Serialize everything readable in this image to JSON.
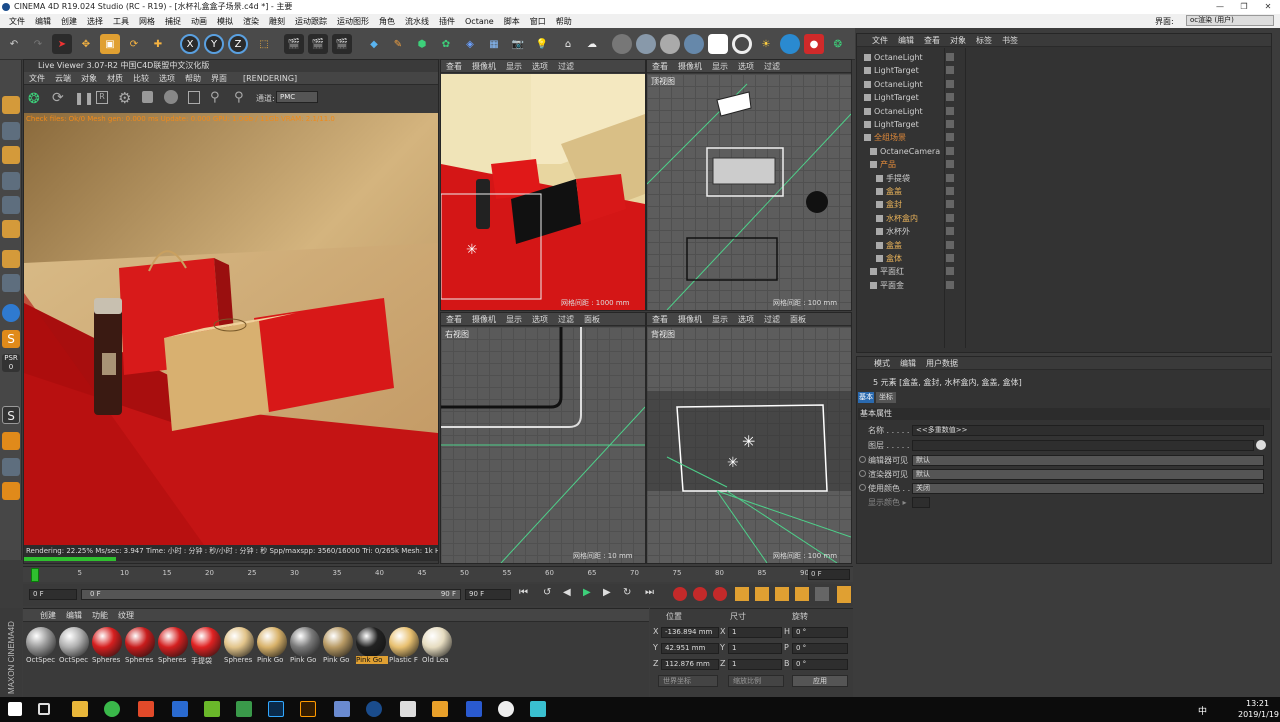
{
  "window": {
    "title": "CINEMA 4D R19.024 Studio (RC - R19) - [水杯礼盒盒子场景.c4d *] - 主要"
  },
  "menu": [
    "文件",
    "编辑",
    "创建",
    "选择",
    "工具",
    "网格",
    "捕捉",
    "动画",
    "模拟",
    "渲染",
    "雕刻",
    "运动跟踪",
    "运动图形",
    "角色",
    "流水线",
    "插件",
    "Octane",
    "脚本",
    "窗口",
    "帮助"
  ],
  "right_menu": {
    "interface_label": "界面:",
    "interface_value": "oc渲染 (用户)"
  },
  "toolbar": {
    "x": "X",
    "y": "Y",
    "z": "Z"
  },
  "live_viewer": {
    "title": "Live Viewer 3.07-R2 中国C4D联盟中文汉化版",
    "menu": [
      "文件",
      "云端",
      "对象",
      "材质",
      "比较",
      "选项",
      "帮助",
      "界面"
    ],
    "status": "[RENDERING]",
    "channel_label": "通道:",
    "channel_value": "PMC",
    "info": "Check files: Ok/0  Mesh gen: 0.000 ms  Update: 0.000  GPU: 1.0Gb / 11Gb  VRAM: 2.1/11.0",
    "render_status": "Rendering: 22.25% Ms/sec: 3.947    Time: 小时 : 分钟 : 秒/小时 : 分钟 : 秒    Spp/maxspp: 3560/16000    Tri: 0/265k    Mesh: 1k    H",
    "progress": 0.2225
  },
  "viewport_menu": [
    "查看",
    "摄像机",
    "显示",
    "选项",
    "过滤",
    "面板"
  ],
  "viewports": [
    {
      "label": "",
      "grid": "网格间距 : 1000 mm"
    },
    {
      "label": "顶视图",
      "grid": "网格间距 : 100 mm"
    },
    {
      "label": "右视图",
      "grid": "网格间距 : 10 mm"
    },
    {
      "label": "背视图",
      "grid": "网格间距 : 100 mm"
    }
  ],
  "objects_menu": [
    "文件",
    "编辑",
    "查看",
    "对象",
    "标签",
    "书签"
  ],
  "objects": [
    {
      "name": "OctaneLight",
      "indent": 0,
      "color": "#cfcfcf"
    },
    {
      "name": "LightTarget",
      "indent": 0,
      "color": "#cfcfcf"
    },
    {
      "name": "OctaneLight",
      "indent": 0,
      "color": "#cfcfcf"
    },
    {
      "name": "LightTarget",
      "indent": 0,
      "color": "#cfcfcf"
    },
    {
      "name": "OctaneLight",
      "indent": 0,
      "color": "#cfcfcf"
    },
    {
      "name": "LightTarget",
      "indent": 0,
      "color": "#cfcfcf"
    },
    {
      "name": "全组场景",
      "indent": 0,
      "color": "#e08a3a"
    },
    {
      "name": "OctaneCamera",
      "indent": 1,
      "color": "#cfcfcf"
    },
    {
      "name": "产品",
      "indent": 1,
      "color": "#e08a3a"
    },
    {
      "name": "手提袋",
      "indent": 2,
      "color": "#cfcfcf"
    },
    {
      "name": "盒盖",
      "indent": 2,
      "color": "#e8b25a"
    },
    {
      "name": "盒封",
      "indent": 2,
      "color": "#e8b25a"
    },
    {
      "name": "水杯盒内",
      "indent": 2,
      "color": "#e8b25a"
    },
    {
      "name": "水杯外",
      "indent": 2,
      "color": "#cfcfcf"
    },
    {
      "name": "盒盖",
      "indent": 2,
      "color": "#e8b25a"
    },
    {
      "name": "盒体",
      "indent": 2,
      "color": "#e8b25a"
    },
    {
      "name": "平面红",
      "indent": 1,
      "color": "#cfcfcf"
    },
    {
      "name": "平面金",
      "indent": 1,
      "color": "#cfcfcf"
    }
  ],
  "attributes": {
    "menu": [
      "模式",
      "编辑",
      "用户数据"
    ],
    "summary": "5 元素 [盒盖, 盒封, 水杯盒内, 盒盖, 盒体]",
    "tabs": [
      "基本",
      "坐标"
    ],
    "section": "基本属性",
    "rows": [
      {
        "label": "名称 . . . . . .",
        "value": "<<多重数值>>"
      },
      {
        "label": "图层 . . . . . .",
        "value": ""
      },
      {
        "label": "编辑器可见",
        "value": "默认"
      },
      {
        "label": "渲染器可见",
        "value": "默认"
      },
      {
        "label": "使用颜色 . . .",
        "value": "关闭"
      },
      {
        "label": "显示颜色 ▸",
        "value": ""
      }
    ]
  },
  "timeline": {
    "ticks": [
      "0",
      "5",
      "10",
      "15",
      "20",
      "25",
      "30",
      "35",
      "40",
      "45",
      "50",
      "55",
      "60",
      "65",
      "70",
      "75",
      "80",
      "85",
      "90"
    ],
    "current_frame": "0 F",
    "start": "0 F",
    "slider_start": "0 F",
    "slider_end": "90 F",
    "end": "90 F"
  },
  "materials": {
    "menu": [
      "创建",
      "编辑",
      "功能",
      "纹理"
    ],
    "items": [
      {
        "name": "OctSpec",
        "color": "#9a9a9a"
      },
      {
        "name": "OctSpec",
        "color": "#b0b0b0"
      },
      {
        "name": "Spheres",
        "color": "#d61f1f"
      },
      {
        "name": "Spheres",
        "color": "#c81c1c"
      },
      {
        "name": "Spheres",
        "color": "#d42020"
      },
      {
        "name": "手提袋",
        "color": "#e02222"
      },
      {
        "name": "Spheres",
        "color": "#e2c48a"
      },
      {
        "name": "Pink Go",
        "color": "#d8b26a"
      },
      {
        "name": "Pink Go",
        "color": "#7a7a7a"
      },
      {
        "name": "Pink Go",
        "color": "#b89a64"
      },
      {
        "name": "Pink Go",
        "color": "#222222"
      },
      {
        "name": "Plastic F",
        "color": "#e8c070"
      },
      {
        "name": "Old Lea",
        "color": "#e6dcc0"
      }
    ]
  },
  "coords": {
    "headers": [
      "位置",
      "尺寸",
      "旋转"
    ],
    "rows": [
      {
        "axis": "X",
        "pos": "-136.894 mm",
        "size": "1",
        "rot_label": "H",
        "rot": "0 °"
      },
      {
        "axis": "Y",
        "pos": "42.951 mm",
        "size": "1",
        "rot_label": "P",
        "rot": "0 °"
      },
      {
        "axis": "Z",
        "pos": "112.876 mm",
        "size": "1",
        "rot_label": "B",
        "rot": "0 °"
      }
    ],
    "mode": "世界坐标",
    "scale": "缩放比例",
    "apply": "应用"
  },
  "taskbar": {
    "time": "13:21",
    "date": "2019/1/19",
    "lang": "中"
  }
}
